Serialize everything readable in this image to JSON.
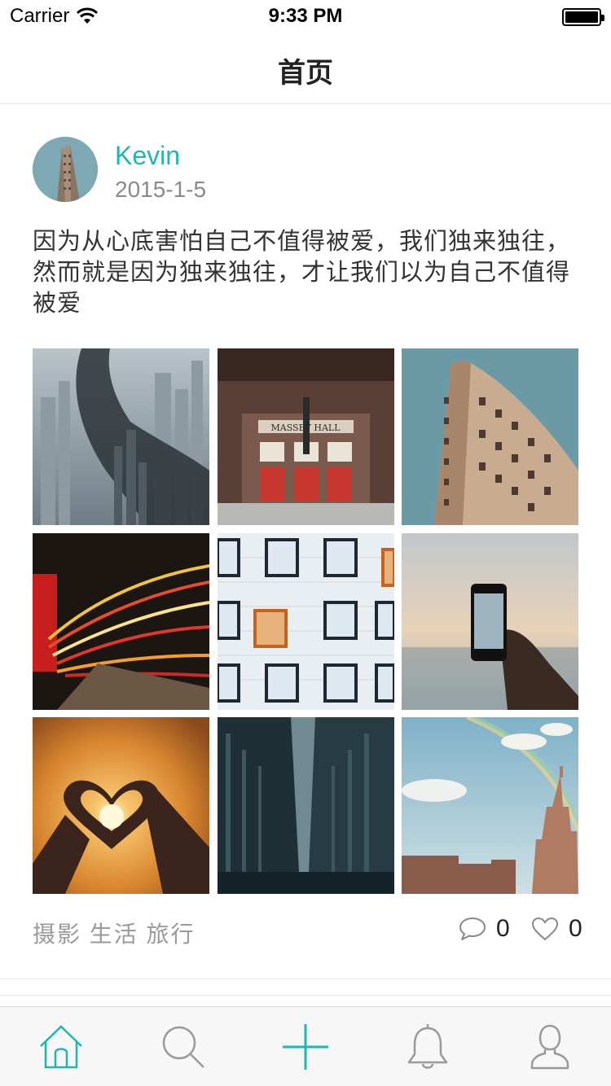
{
  "status_bar": {
    "carrier": "Carrier",
    "time": "9:33 PM"
  },
  "nav": {
    "title": "首页"
  },
  "post": {
    "username": "Kevin",
    "date": "2015-1-5",
    "content": "因为从心底害怕自己不值得被爱，我们独来独往，然而就是因为独来独往，才让我们以为自己不值得被爱",
    "images": [
      {
        "icon": "city-silhouette-photo"
      },
      {
        "icon": "massey-hall-photo"
      },
      {
        "icon": "flatiron-building-photo"
      },
      {
        "icon": "light-trails-photo"
      },
      {
        "icon": "building-windows-photo"
      },
      {
        "icon": "phone-beach-photo"
      },
      {
        "icon": "heart-hands-sunset-photo"
      },
      {
        "icon": "city-street-skyscrapers-photo"
      },
      {
        "icon": "rainbow-skyline-photo"
      }
    ],
    "tags": "摄影 生活 旅行",
    "comment_count": "0",
    "like_count": "0"
  },
  "tabbar": {
    "items": [
      {
        "icon": "home-icon",
        "active": true
      },
      {
        "icon": "search-icon",
        "active": false
      },
      {
        "icon": "plus-icon",
        "active": false
      },
      {
        "icon": "bell-icon",
        "active": false
      },
      {
        "icon": "profile-icon",
        "active": false
      }
    ]
  },
  "colors": {
    "accent": "#1fb7ae",
    "text": "#333333",
    "muted": "#9a9a9a",
    "tabbar_bg": "#f7f7f7"
  }
}
